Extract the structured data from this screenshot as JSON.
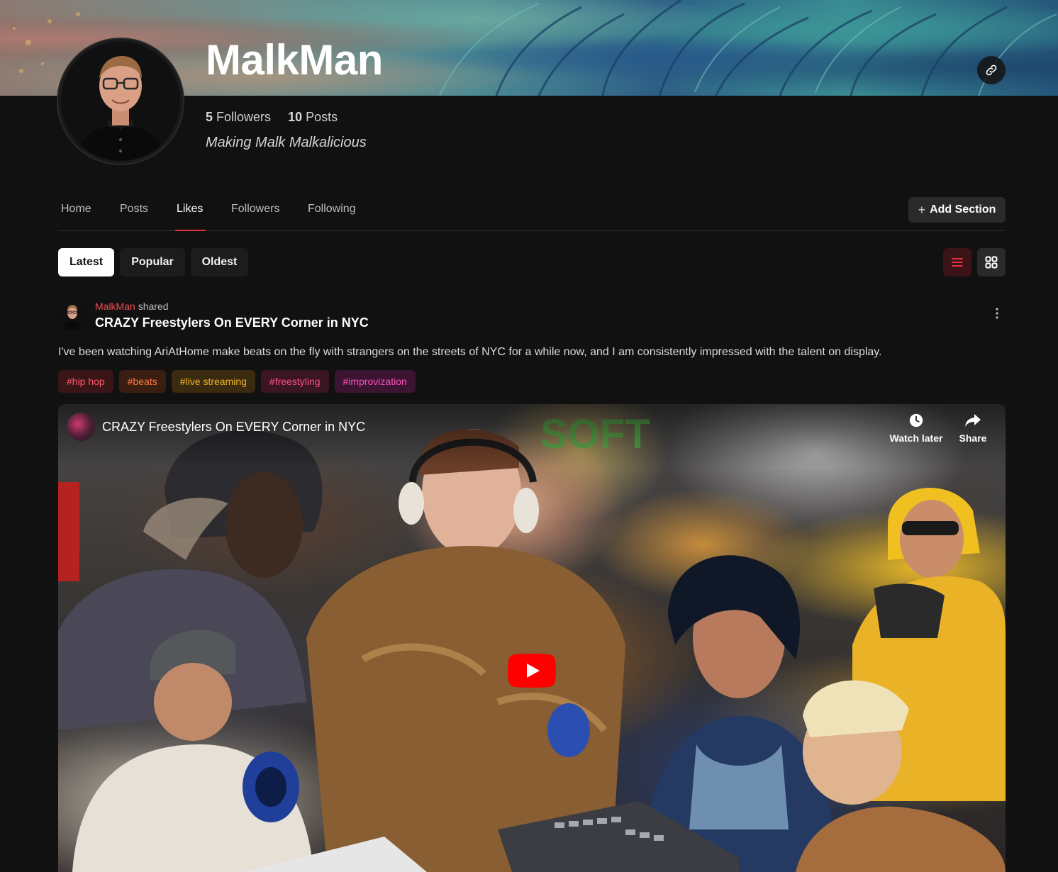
{
  "profile": {
    "name": "MalkMan",
    "followers_count": "5",
    "followers_label": "Followers",
    "posts_count": "10",
    "posts_label": "Posts",
    "tagline": "Making Malk Malkalicious"
  },
  "nav": {
    "tabs": [
      {
        "label": "Home",
        "active": false
      },
      {
        "label": "Posts",
        "active": false
      },
      {
        "label": "Likes",
        "active": true
      },
      {
        "label": "Followers",
        "active": false
      },
      {
        "label": "Following",
        "active": false
      }
    ],
    "add_section_label": "Add Section"
  },
  "sort": {
    "options": [
      {
        "label": "Latest",
        "active": true
      },
      {
        "label": "Popular",
        "active": false
      },
      {
        "label": "Oldest",
        "active": false
      }
    ],
    "view_modes": [
      "list-icon",
      "grid-icon"
    ],
    "active_view": "list"
  },
  "post": {
    "author": "MalkMan",
    "action": "shared",
    "title": "CRAZY Freestylers On EVERY Corner in NYC",
    "body": "I've been watching AriAtHome make beats on the fly with strangers on the streets of NYC for a while now, and I am consistently impressed with the talent on display.",
    "tags": [
      {
        "label": "#hip hop",
        "color": "#ff5a67",
        "bg": "#3a1518"
      },
      {
        "label": "#beats",
        "color": "#ff7a3d",
        "bg": "#3a1e12"
      },
      {
        "label": "#live streaming",
        "color": "#f0b429",
        "bg": "#3a2a10"
      },
      {
        "label": "#freestyling",
        "color": "#ff4f8a",
        "bg": "#3a1524"
      },
      {
        "label": "#improvization",
        "color": "#ff4fc1",
        "bg": "#3a1430"
      }
    ],
    "video": {
      "title": "CRAZY Freestylers On EVERY Corner in NYC",
      "watch_later_label": "Watch later",
      "share_label": "Share"
    }
  },
  "colors": {
    "accent": "#e0323c",
    "background": "#111111",
    "youtube_red": "#ff0000"
  }
}
